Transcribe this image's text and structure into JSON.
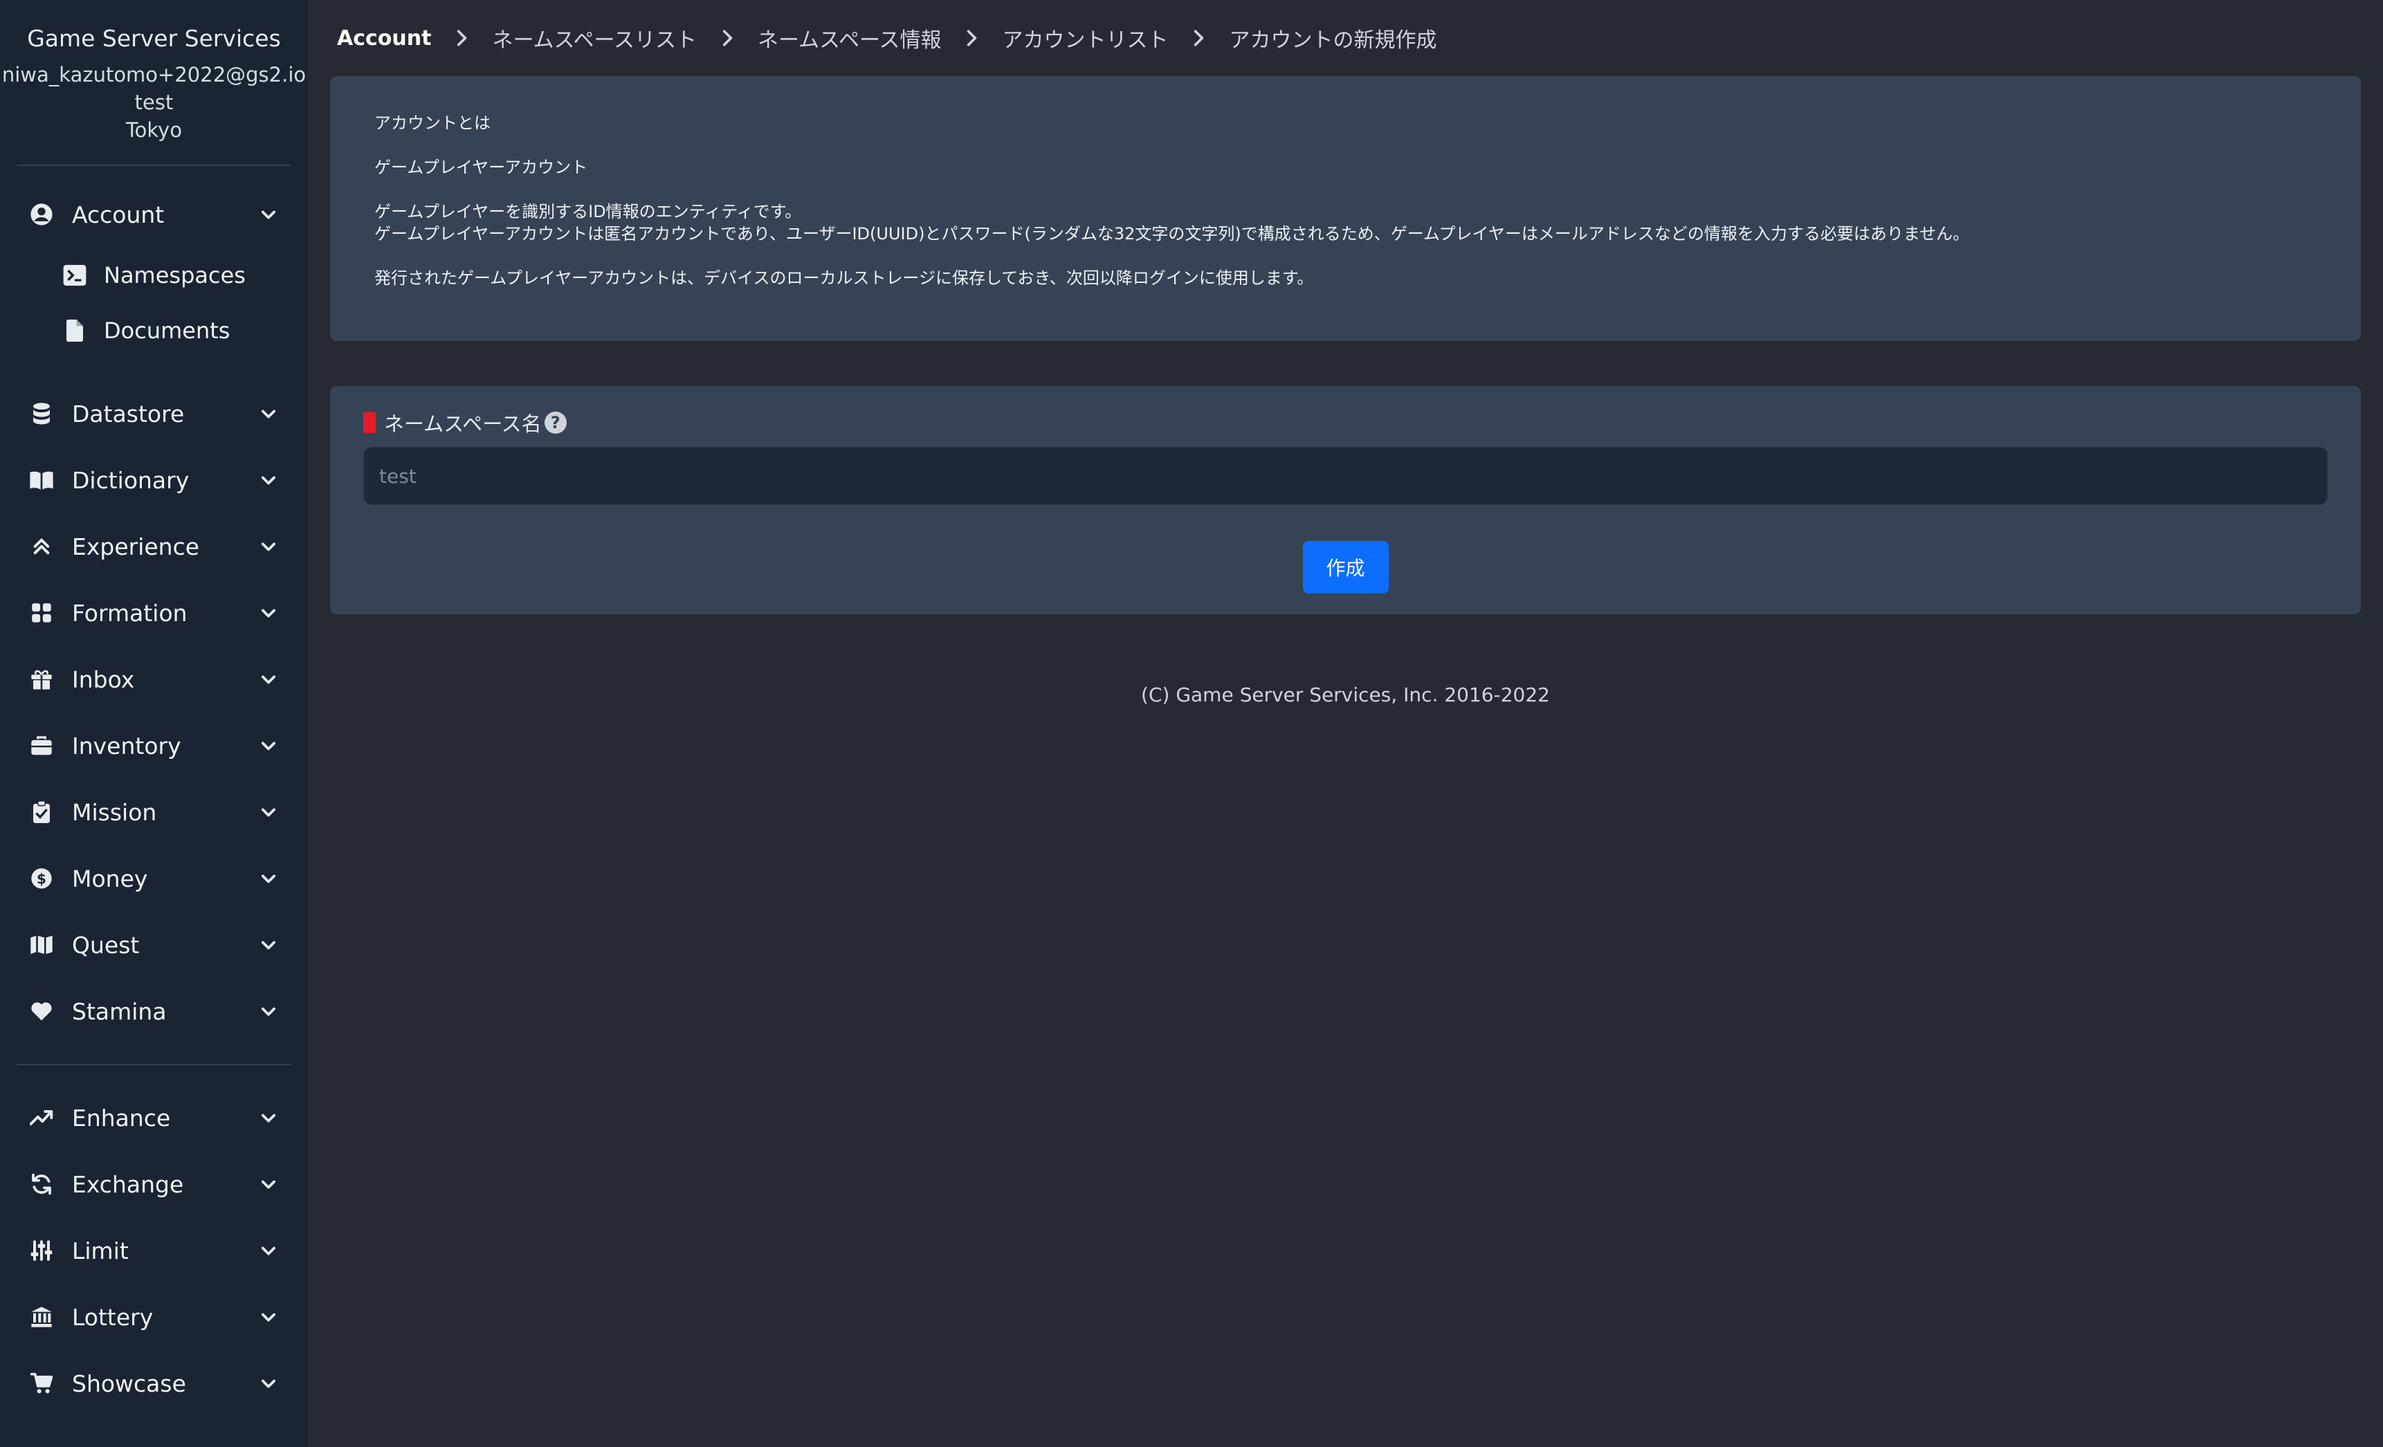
{
  "app": {
    "title": "Game Server Services"
  },
  "user": {
    "email": "niwa_kazutomo+2022@gs2.io",
    "project": "test",
    "region": "Tokyo"
  },
  "sidebar": {
    "account": {
      "label": "Account",
      "icon": "user-circle-icon"
    },
    "sub_items": [
      {
        "label": "Namespaces",
        "icon": "terminal-icon"
      },
      {
        "label": "Documents",
        "icon": "document-icon"
      }
    ],
    "group1": [
      {
        "label": "Datastore",
        "icon": "database-icon"
      },
      {
        "label": "Dictionary",
        "icon": "book-icon"
      },
      {
        "label": "Experience",
        "icon": "double-chevron-up-icon"
      },
      {
        "label": "Formation",
        "icon": "grid-icon"
      },
      {
        "label": "Inbox",
        "icon": "gift-icon"
      },
      {
        "label": "Inventory",
        "icon": "briefcase-icon"
      },
      {
        "label": "Mission",
        "icon": "clipboard-check-icon"
      },
      {
        "label": "Money",
        "icon": "dollar-coin-icon"
      },
      {
        "label": "Quest",
        "icon": "map-icon"
      },
      {
        "label": "Stamina",
        "icon": "heart-icon"
      }
    ],
    "group2": [
      {
        "label": "Enhance",
        "icon": "trend-up-icon"
      },
      {
        "label": "Exchange",
        "icon": "exchange-icon"
      },
      {
        "label": "Limit",
        "icon": "sliders-icon"
      },
      {
        "label": "Lottery",
        "icon": "bank-icon"
      },
      {
        "label": "Showcase",
        "icon": "cart-icon"
      }
    ]
  },
  "breadcrumb": [
    "Account",
    "ネームスペースリスト",
    "ネームスペース情報",
    "アカウントリスト",
    "アカウントの新規作成"
  ],
  "info": {
    "heading": "アカウントとは",
    "subheading": "ゲームプレイヤーアカウント",
    "line1": "ゲームプレイヤーを識別するID情報のエンティティです。",
    "line2": "ゲームプレイヤーアカウントは匿名アカウントであり、ユーザーID(UUID)とパスワード(ランダムな32文字の文字列)で構成されるため、ゲームプレイヤーはメールアドレスなどの情報を入力する必要はありません。",
    "line3": "発行されたゲームプレイヤーアカウントは、デバイスのローカルストレージに保存しておき、次回以降ログインに使用します。"
  },
  "form": {
    "label": "ネームスペース名",
    "help": "?",
    "placeholder": "test",
    "value": "",
    "submit": "作成"
  },
  "footer": {
    "copyright": "(C) Game Server Services, Inc. 2016-2022"
  },
  "colors": {
    "sidebar": "#1a2433",
    "background": "#262a35",
    "card": "#364355",
    "accent": "#0d6efd",
    "required": "#e51c2b"
  }
}
